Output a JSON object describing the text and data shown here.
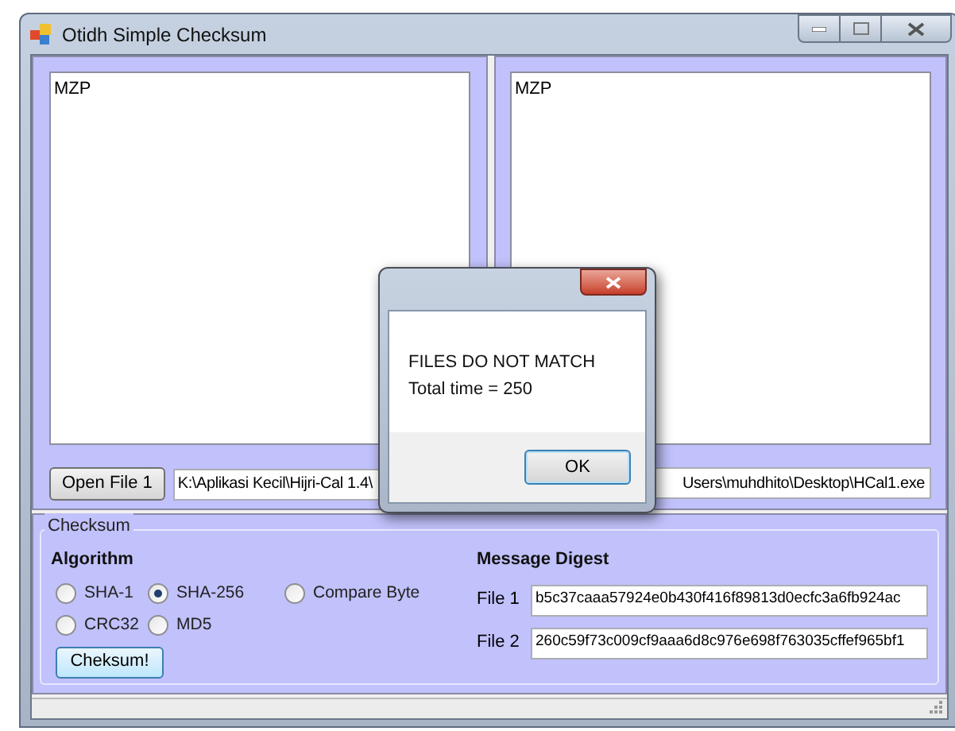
{
  "window": {
    "title": "Otidh Simple Checksum"
  },
  "files": [
    {
      "content": "MZP",
      "button": "Open File 1",
      "path": "K:\\Aplikasi Kecil\\Hijri-Cal 1.4\\"
    },
    {
      "content": "MZP",
      "path": "Users\\muhdhito\\Desktop\\HCal1.exe"
    }
  ],
  "checksum": {
    "title": "Checksum",
    "algorithm_label": "Algorithm",
    "algorithms": [
      {
        "label": "SHA-1",
        "selected": false
      },
      {
        "label": "SHA-256",
        "selected": true
      },
      {
        "label": "Compare Byte",
        "selected": false
      },
      {
        "label": "CRC32",
        "selected": false
      },
      {
        "label": "MD5",
        "selected": false
      }
    ],
    "button": "Cheksum!",
    "digest_label": "Message Digest",
    "digests": [
      {
        "label": "File 1",
        "value": "b5c37caaa57924e0b430f416f89813d0ecfc3a6fb924ac"
      },
      {
        "label": "File 2",
        "value": "260c59f73c009cf9aaa6d8c976e698f763035cffef965bf1"
      }
    ]
  },
  "dialog": {
    "message": "FILES DO NOT MATCH",
    "detail": "Total time = 250",
    "button": "OK"
  }
}
